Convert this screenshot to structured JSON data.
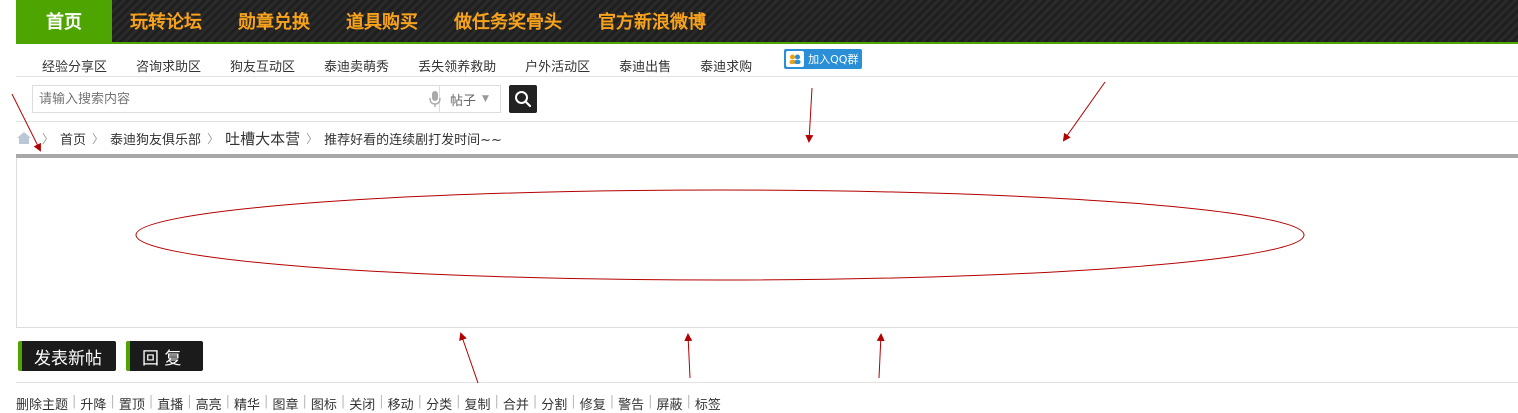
{
  "topnav": {
    "items": [
      "首页",
      "玩转论坛",
      "勋章兑换",
      "道具购买",
      "做任务奖骨头",
      "官方新浪微博"
    ]
  },
  "subnav": {
    "items": [
      "经验分享区",
      "咨询求助区",
      "狗友互动区",
      "泰迪卖萌秀",
      "丢失领养救助",
      "户外活动区",
      "泰迪出售",
      "泰迪求购"
    ],
    "qq_label": "加入QQ群"
  },
  "search": {
    "placeholder": "请输入搜索内容",
    "type_value": "帖子"
  },
  "breadcrumb": {
    "items": [
      "首页",
      "泰迪狗友俱乐部",
      "吐槽大本营",
      "推荐好看的连续剧打发时间~~"
    ]
  },
  "actions": {
    "new_post": "发表新帖",
    "reply": "回 复"
  },
  "admin_links": [
    "删除主题",
    "升降",
    "置顶",
    "直播",
    "高亮",
    "精华",
    "图章",
    "图标",
    "关闭",
    "移动",
    "分类",
    "复制",
    "合并",
    "分割",
    "修复",
    "警告",
    "屏蔽",
    "标签"
  ],
  "colors": {
    "accent_green": "#4ea400",
    "nav_orange": "#f7a21c",
    "annotation_red": "#b30000"
  }
}
